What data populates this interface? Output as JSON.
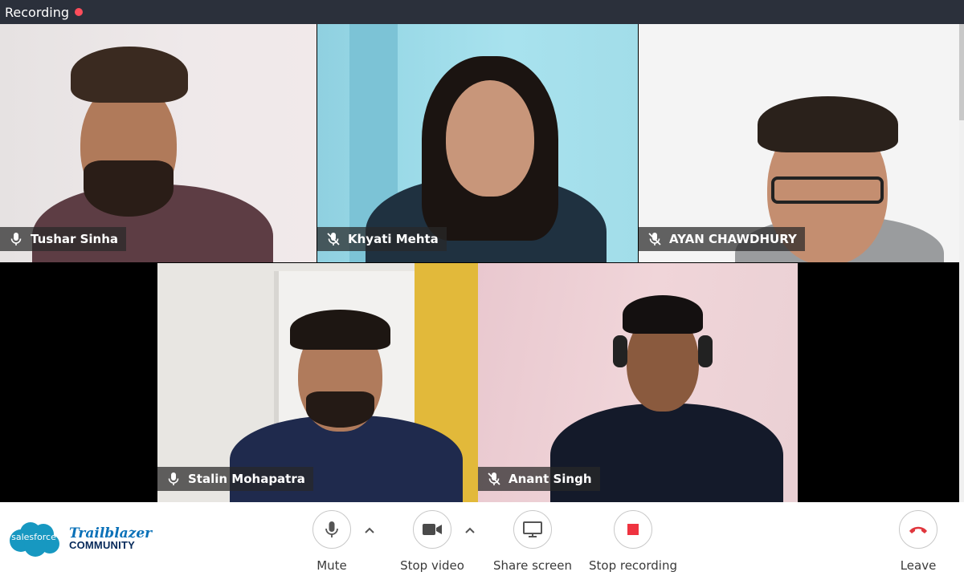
{
  "recording_bar": {
    "label": "Recording"
  },
  "participants": [
    {
      "name": "Tushar Sinha",
      "mic": "on"
    },
    {
      "name": "Khyati Mehta",
      "mic": "muted"
    },
    {
      "name": "AYAN CHAWDHURY",
      "mic": "muted"
    },
    {
      "name": "Stalin Mohapatra",
      "mic": "on"
    },
    {
      "name": "Anant Singh",
      "mic": "muted"
    }
  ],
  "branding": {
    "salesforce": "salesforce",
    "trailblazer": "Trailblazer",
    "community": "COMMUNITY"
  },
  "controls": {
    "mute": "Mute",
    "stop_video": "Stop video",
    "share_screen": "Share screen",
    "stop_recording": "Stop recording",
    "leave": "Leave"
  },
  "colors": {
    "topbar": "#2b303b",
    "record": "#ff4d5b",
    "leave": "#e0363d"
  }
}
